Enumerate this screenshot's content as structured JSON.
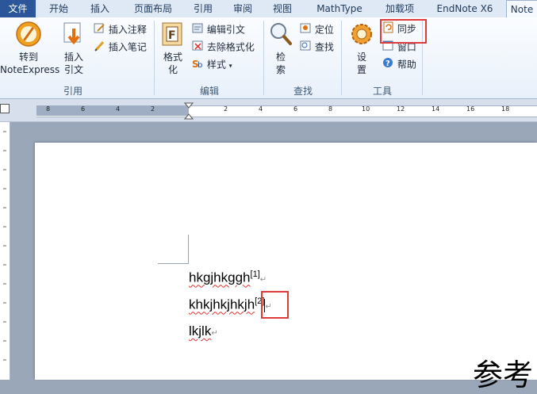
{
  "tabs": [
    "文件",
    "开始",
    "插入",
    "页面布局",
    "引用",
    "审阅",
    "视图",
    "MathType",
    "加载项",
    "EndNote X6",
    "Note"
  ],
  "ribbon": {
    "groups": {
      "cite": "引用",
      "edit": "编辑",
      "find": "查找",
      "tools": "工具"
    },
    "goto_label_1": "转到",
    "goto_label_2": "NoteExpress",
    "insert_cite_1": "插入",
    "insert_cite_2": "引文",
    "insert_note": "插入注释",
    "insert_memo": "插入笔记",
    "format_1": "格式",
    "format_2": "化",
    "edit_cite": "编辑引文",
    "remove_format": "去除格式化",
    "style": "样式",
    "search_1": "检",
    "search_2": "索",
    "locate": "定位",
    "find": "查找",
    "settings_1": "设",
    "settings_2": "置",
    "sync": "同步",
    "window": "窗口",
    "help": "帮助"
  },
  "ruler": {
    "numbers": [
      "8",
      "6",
      "4",
      "2",
      "2",
      "4",
      "6",
      "8",
      "10",
      "12",
      "14",
      "16",
      "18"
    ]
  },
  "document": {
    "lines": [
      {
        "text": "hkgjhkggh",
        "sup": "[1]"
      },
      {
        "text": "khkjhkjhkjh",
        "sup": "[2]"
      },
      {
        "text": "lkjlk",
        "sup": ""
      }
    ],
    "pilcrow": "↵",
    "heading_partial": "参考"
  },
  "colors": {
    "file_tab": "#2b579a",
    "highlight": "#e03b3b",
    "ribbon_bg": "#e8f0fa"
  }
}
